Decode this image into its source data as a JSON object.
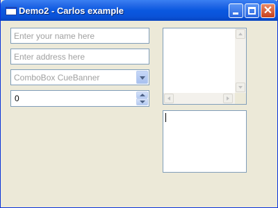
{
  "window": {
    "title": "Demo2 - Carlos example"
  },
  "form": {
    "name_placeholder": "Enter your name here",
    "address_placeholder": "Enter address here",
    "combo_cue_banner": "ComboBox CueBanner",
    "spinner_value": "0"
  },
  "memo": {
    "text": ""
  },
  "icons": {
    "app": "window-icon",
    "minimize": "minimize-icon",
    "maximize": "maximize-icon",
    "close": "close-icon"
  },
  "colors": {
    "titlebar": "#0a58e0",
    "close_button": "#c6411d",
    "window_background": "#ece9d8",
    "field_border": "#7f9db9"
  }
}
